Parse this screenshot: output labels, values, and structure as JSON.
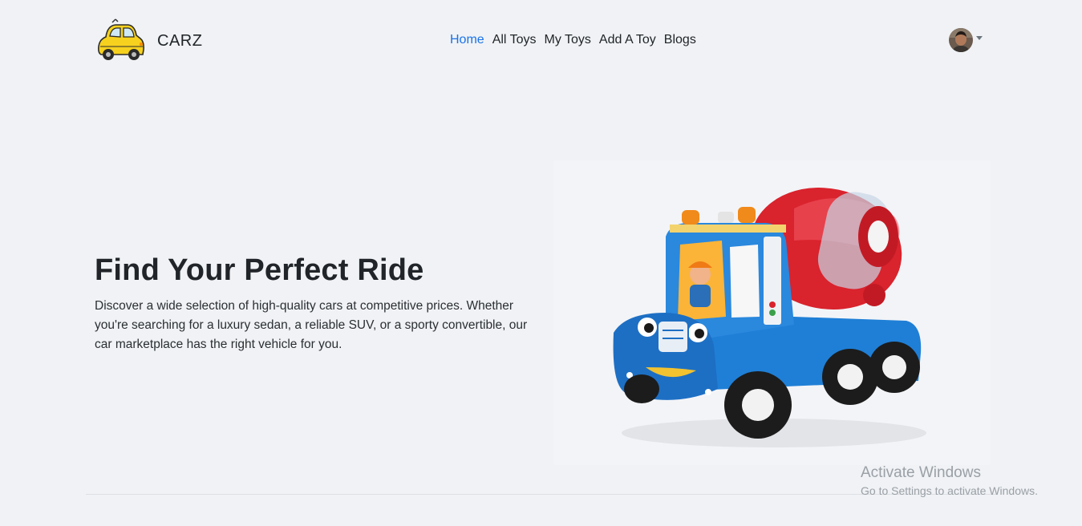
{
  "brand": {
    "name": "CARZ",
    "logo_icon": "yellow-car-logo-icon"
  },
  "nav": {
    "links": [
      {
        "label": "Home",
        "active": true
      },
      {
        "label": "All Toys",
        "active": false
      },
      {
        "label": "My Toys",
        "active": false
      },
      {
        "label": "Add A Toy",
        "active": false
      },
      {
        "label": "Blogs",
        "active": false
      }
    ],
    "active_color": "#1a73e8"
  },
  "profile": {
    "avatar_icon": "user-avatar-icon",
    "menu_icon": "caret-down-icon"
  },
  "hero": {
    "title": "Find Your Perfect Ride",
    "description": "Discover a wide selection of high-quality cars at competitive prices. Whether you're searching for a luxury sedan, a reliable SUV, or a sporty convertible, our car marketplace has the right vehicle for you.",
    "image_icon": "toy-cement-mixer-truck-image"
  },
  "watermark": {
    "title": "Activate Windows",
    "subtitle": "Go to Settings to activate Windows."
  }
}
